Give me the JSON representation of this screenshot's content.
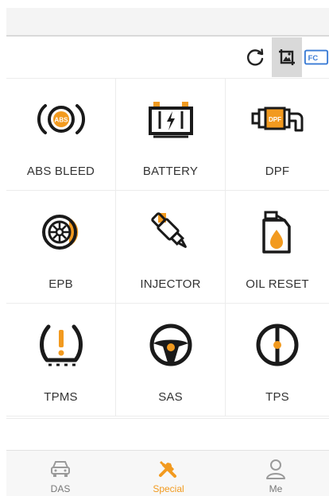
{
  "colors": {
    "accent": "#f29a1f",
    "icon_dark": "#1a1a1a",
    "inactive": "#9a9a9a"
  },
  "toolbar": {
    "icons": [
      "refresh-icon",
      "screenshot-icon",
      "report-icon"
    ],
    "report_text": "FC"
  },
  "functions": [
    {
      "label": "ABS BLEED",
      "icon": "abs-icon"
    },
    {
      "label": "BATTERY",
      "icon": "battery-icon"
    },
    {
      "label": "DPF",
      "icon": "dpf-icon"
    },
    {
      "label": "EPB",
      "icon": "epb-icon"
    },
    {
      "label": "INJECTOR",
      "icon": "injector-icon"
    },
    {
      "label": "OIL RESET",
      "icon": "oil-icon"
    },
    {
      "label": "TPMS",
      "icon": "tpms-icon"
    },
    {
      "label": "SAS",
      "icon": "steering-wheel-icon"
    },
    {
      "label": "TPS",
      "icon": "tps-icon"
    }
  ],
  "abs_text": "ABS",
  "dpf_text": "DPF",
  "bottom_nav": [
    {
      "label": "DAS",
      "icon": "car-icon",
      "active": false
    },
    {
      "label": "Special",
      "icon": "tools-icon",
      "active": true
    },
    {
      "label": "Me",
      "icon": "user-icon",
      "active": false
    }
  ]
}
